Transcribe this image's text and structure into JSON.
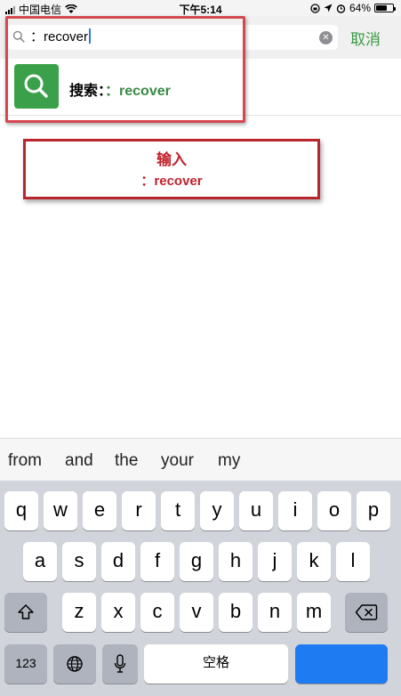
{
  "status_bar": {
    "carrier": "中国电信",
    "time": "下午5:14",
    "battery_percent": "64%",
    "battery_level": 0.64
  },
  "search": {
    "query": "：recover",
    "cancel_label": "取消"
  },
  "result": {
    "prefix": "搜索：",
    "keyword": "：recover"
  },
  "annotation": {
    "line1": "输入",
    "line2": "：recover",
    "color": "#c0222c"
  },
  "suggestions": [
    "from",
    "and",
    "the",
    "your",
    "my"
  ],
  "keyboard": {
    "row1": [
      "q",
      "w",
      "e",
      "r",
      "t",
      "y",
      "u",
      "i",
      "o",
      "p"
    ],
    "row2": [
      "a",
      "s",
      "d",
      "f",
      "g",
      "h",
      "j",
      "k",
      "l"
    ],
    "row3": [
      "z",
      "x",
      "c",
      "v",
      "b",
      "n",
      "m"
    ],
    "numbers_label": "123",
    "space_label": "空格"
  },
  "colors": {
    "accent_green": "#3a9a47",
    "search_icon_bg": "#3aa14a",
    "return_key": "#1f7bf2"
  }
}
